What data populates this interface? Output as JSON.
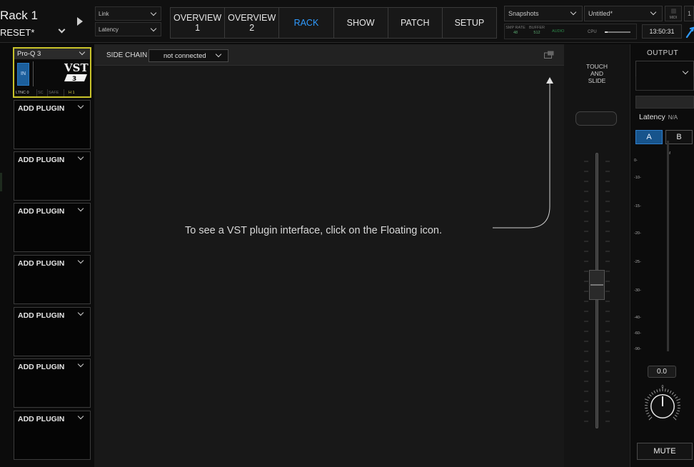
{
  "header": {
    "rack_name": "Rack 1",
    "preset": "RESET*",
    "link_label": "Link",
    "latency_label": "Latency",
    "nav_tabs": [
      {
        "line1": "OVERVIEW",
        "line2": "1"
      },
      {
        "line1": "OVERVIEW",
        "line2": "2"
      },
      {
        "line1": "RACK",
        "line2": ""
      },
      {
        "line1": "SHOW",
        "line2": ""
      },
      {
        "line1": "PATCH",
        "line2": ""
      },
      {
        "line1": "SETUP",
        "line2": ""
      }
    ],
    "active_tab": "RACK",
    "snapshots_label": "Snapshots",
    "snapshot_name": "Untitled*",
    "midi_label": "MIDI",
    "clipped_edge_text": "1",
    "status": {
      "smp_rate_label": "SMP RATE",
      "smp_rate_value": "48",
      "buffer_label": "BUFFER",
      "buffer_value": "512",
      "audio_label": "AUDIO",
      "cpu_label": "CPU",
      "cpu_fraction": 0.1
    },
    "clock": "13:50:31"
  },
  "plugin_column": {
    "first_plugin": {
      "name": "Pro-Q 3",
      "in_label": "IN",
      "logo_text": "VST",
      "logo_version": "3",
      "latency_text": "LTNC 0",
      "sc_label": "SC",
      "safe_label": "SAFE",
      "badge": "H 1"
    },
    "add_plugin_label": "ADD PLUGIN",
    "empty_slots": [
      "ADD PLUGIN",
      "ADD PLUGIN",
      "ADD PLUGIN",
      "ADD PLUGIN",
      "ADD PLUGIN",
      "ADD PLUGIN",
      "ADD PLUGIN"
    ]
  },
  "main": {
    "side_chain_label": "SIDE CHAIN",
    "side_chain_value": "not connected",
    "hint": "To see a VST plugin interface, click on the Floating icon."
  },
  "touch_slide": {
    "label_lines": [
      "TOUCH",
      "AND",
      "SLIDE"
    ]
  },
  "output": {
    "label": "OUTPUT",
    "latency_label": "Latency",
    "latency_value": "N/A",
    "a_label": "A",
    "b_label": "B",
    "meter_channel": "M",
    "meter_ticks": [
      "0-",
      "-10-",
      "-15-",
      "-20-",
      "-25-",
      "-30-",
      "-40-",
      "-60-",
      "-90-"
    ],
    "level": "0.0",
    "knob_tick": "0",
    "mute_label": "MUTE"
  },
  "colors": {
    "accent": "#2f9bff",
    "selected_plugin_border": "#c9c32a",
    "background": "#181818"
  }
}
